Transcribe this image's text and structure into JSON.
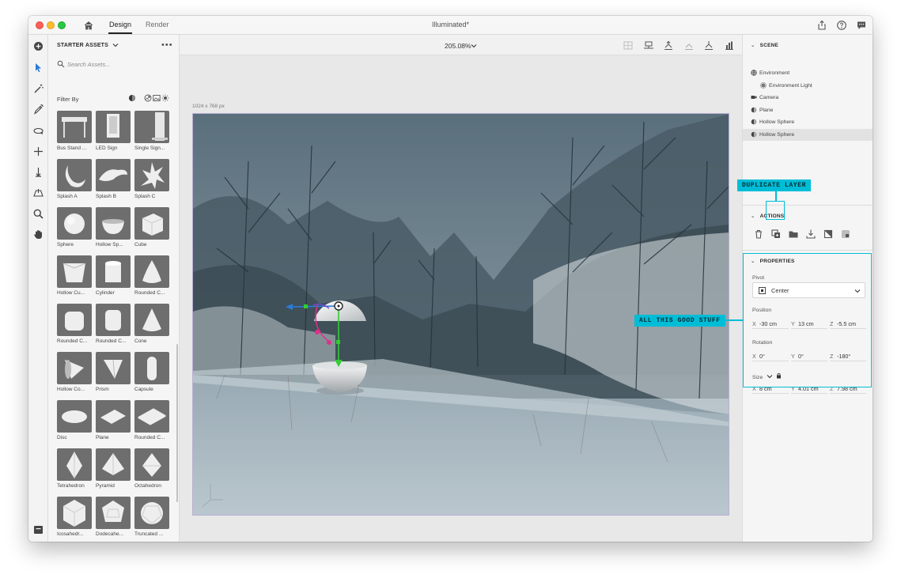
{
  "window": {
    "title": "Illuminated*",
    "tabs": [
      "Design",
      "Render"
    ]
  },
  "assets": {
    "header": "STARTER ASSETS",
    "more": "•••",
    "search_placeholder": "Search Assets...",
    "filter_label": "Filter By",
    "items": [
      {
        "label": "Bus Stand ...",
        "shape": "bus-stand"
      },
      {
        "label": "LED Sign",
        "shape": "led-sign"
      },
      {
        "label": "Single Sign...",
        "shape": "single-sign"
      },
      {
        "label": "Splash A",
        "shape": "splash-a"
      },
      {
        "label": "Splash B",
        "shape": "splash-b"
      },
      {
        "label": "Splash C",
        "shape": "splash-c"
      },
      {
        "label": "Sphere",
        "shape": "sphere"
      },
      {
        "label": "Hollow Sp...",
        "shape": "hollow-sphere"
      },
      {
        "label": "Cube",
        "shape": "cube"
      },
      {
        "label": "Hollow Cu...",
        "shape": "hollow-cube"
      },
      {
        "label": "Cylinder",
        "shape": "cylinder"
      },
      {
        "label": "Rounded C...",
        "shape": "rounded-cone"
      },
      {
        "label": "Rounded C...",
        "shape": "rounded-cube"
      },
      {
        "label": "Rounded C...",
        "shape": "rounded-cylinder"
      },
      {
        "label": "Cone",
        "shape": "cone"
      },
      {
        "label": "Hollow Co...",
        "shape": "hollow-cone"
      },
      {
        "label": "Prism",
        "shape": "prism"
      },
      {
        "label": "Capsule",
        "shape": "capsule"
      },
      {
        "label": "Disc",
        "shape": "disc"
      },
      {
        "label": "Plane",
        "shape": "plane"
      },
      {
        "label": "Rounded C...",
        "shape": "rounded-plane"
      },
      {
        "label": "Tetrahedron",
        "shape": "tetrahedron"
      },
      {
        "label": "Pyramid",
        "shape": "pyramid"
      },
      {
        "label": "Octahedron",
        "shape": "octahedron"
      },
      {
        "label": "Icosahedr...",
        "shape": "icosahedron"
      },
      {
        "label": "Dodecahe...",
        "shape": "dodecahedron"
      },
      {
        "label": "Truncated ...",
        "shape": "truncated"
      },
      {
        "label": "",
        "shape": "partial-1"
      },
      {
        "label": "",
        "shape": "partial-2"
      },
      {
        "label": "",
        "shape": "partial-3"
      }
    ]
  },
  "canvas": {
    "zoom": "205.08%",
    "size_label": "1024 x 768 px"
  },
  "scene": {
    "header": "SCENE",
    "layers": [
      {
        "label": "Environment",
        "icon": "environment-icon"
      },
      {
        "label": "Environment Light",
        "icon": "light-icon"
      },
      {
        "label": "Camera",
        "icon": "camera-icon"
      },
      {
        "label": "Plane",
        "icon": "object-icon"
      },
      {
        "label": "Hollow Sphere",
        "icon": "object-icon"
      },
      {
        "label": "Hollow Sphere",
        "icon": "object-icon",
        "selected": true
      }
    ]
  },
  "actions": {
    "header": "ACTIONS"
  },
  "properties": {
    "header": "PROPERTIES",
    "pivot_label": "Pivot",
    "pivot_value": "Center",
    "position_label": "Position",
    "position": {
      "x": "-30 cm",
      "y": "13 cm",
      "z": "-5.5 cm"
    },
    "rotation_label": "Rotation",
    "rotation": {
      "x": "0°",
      "y": "0°",
      "z": "-180°"
    },
    "size_label": "Size",
    "size": {
      "x": "8 cm",
      "y": "4.01 cm",
      "z": "7.98 cm"
    },
    "axes": {
      "x": "X",
      "y": "Y",
      "z": "Z"
    }
  },
  "callouts": {
    "duplicate": "DUPLICATE LAYER",
    "good_stuff": "ALL THIS GOOD STUFF"
  },
  "colors": {
    "accent": "#00bdd7",
    "gizmo_y": "#33cc33",
    "gizmo_x": "#2a7bd8",
    "gizmo_rot": "#e0308a"
  }
}
